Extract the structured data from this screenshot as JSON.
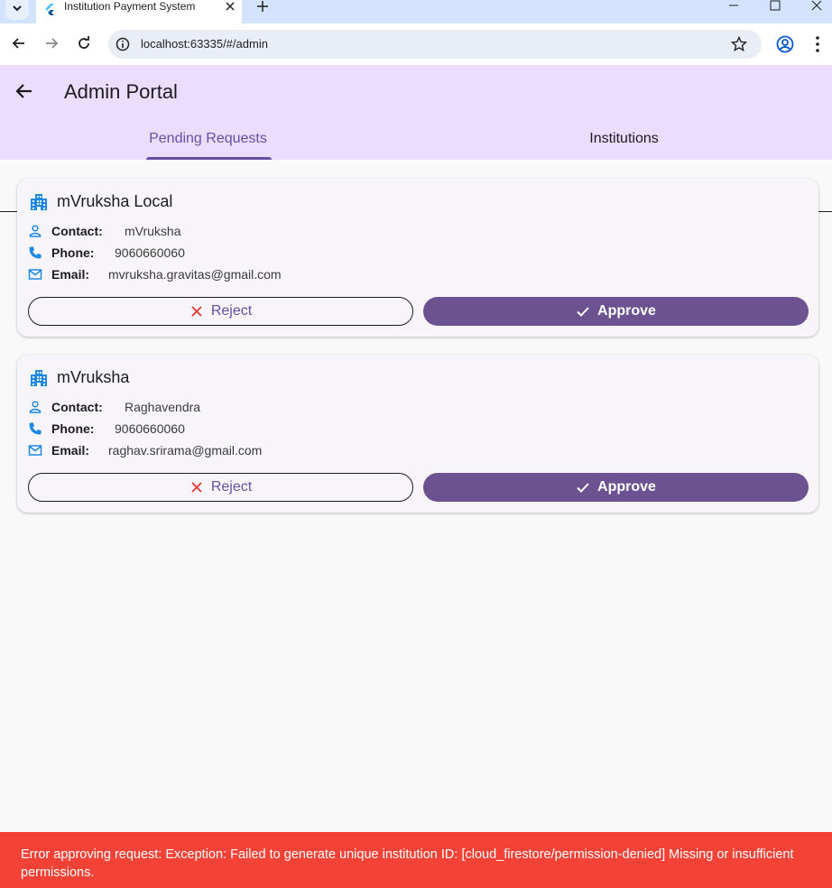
{
  "browser": {
    "tab_title": "Institution Payment System",
    "url": "localhost:63335/#/admin"
  },
  "appbar": {
    "title": "Admin Portal",
    "tabs": [
      {
        "label": "Pending Requests",
        "active": true
      },
      {
        "label": "Institutions",
        "active": false
      }
    ]
  },
  "requests": [
    {
      "name": "mVruksha Local",
      "contact_key": "Contact:",
      "contact": "mVruksha",
      "phone_key": "Phone:",
      "phone": "9060660060",
      "email_key": "Email:",
      "email": "mvruksha.gravitas@gmail.com",
      "reject_label": "Reject",
      "approve_label": "Approve"
    },
    {
      "name": "mVruksha",
      "contact_key": "Contact:",
      "contact": "Raghavendra",
      "phone_key": "Phone:",
      "phone": "9060660060",
      "email_key": "Email:",
      "email": "raghav.srirama@gmail.com",
      "reject_label": "Reject",
      "approve_label": "Approve"
    }
  ],
  "snackbar": {
    "message": "Error approving request: Exception: Failed to generate unique institution ID: [cloud_firestore/permission-denied] Missing or insufficient permissions."
  },
  "colors": {
    "primary": "#6750a4",
    "approve_bg": "#6c5290",
    "appbar_bg": "#eaddff",
    "error": "#f44336",
    "icon_blue": "#1e88e5",
    "reject_icon": "#e53935"
  }
}
